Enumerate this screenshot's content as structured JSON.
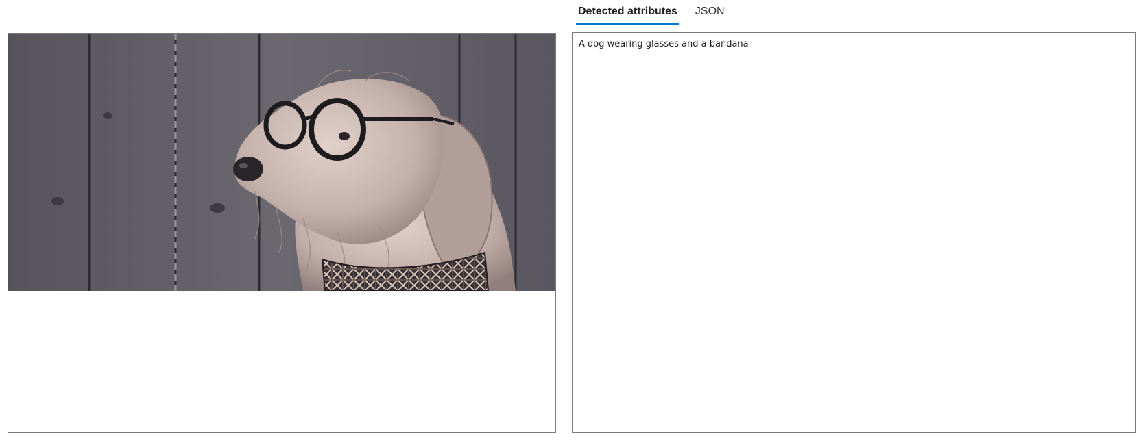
{
  "tabs": [
    {
      "label": "Detected attributes",
      "active": true
    },
    {
      "label": "JSON",
      "active": false
    }
  ],
  "attributes": {
    "caption": "A dog wearing glasses and a bandana"
  },
  "image": {
    "subject": "dog wearing glasses and a bandana",
    "colors": {
      "fence": "#5d5a60",
      "fence_dark": "#3e3b40",
      "fur": "#c9b6b0",
      "fur_shadow": "#9c8a86",
      "glasses": "#1e1b1e",
      "bandana": "#3a3038",
      "accent": "#0078d4"
    }
  }
}
